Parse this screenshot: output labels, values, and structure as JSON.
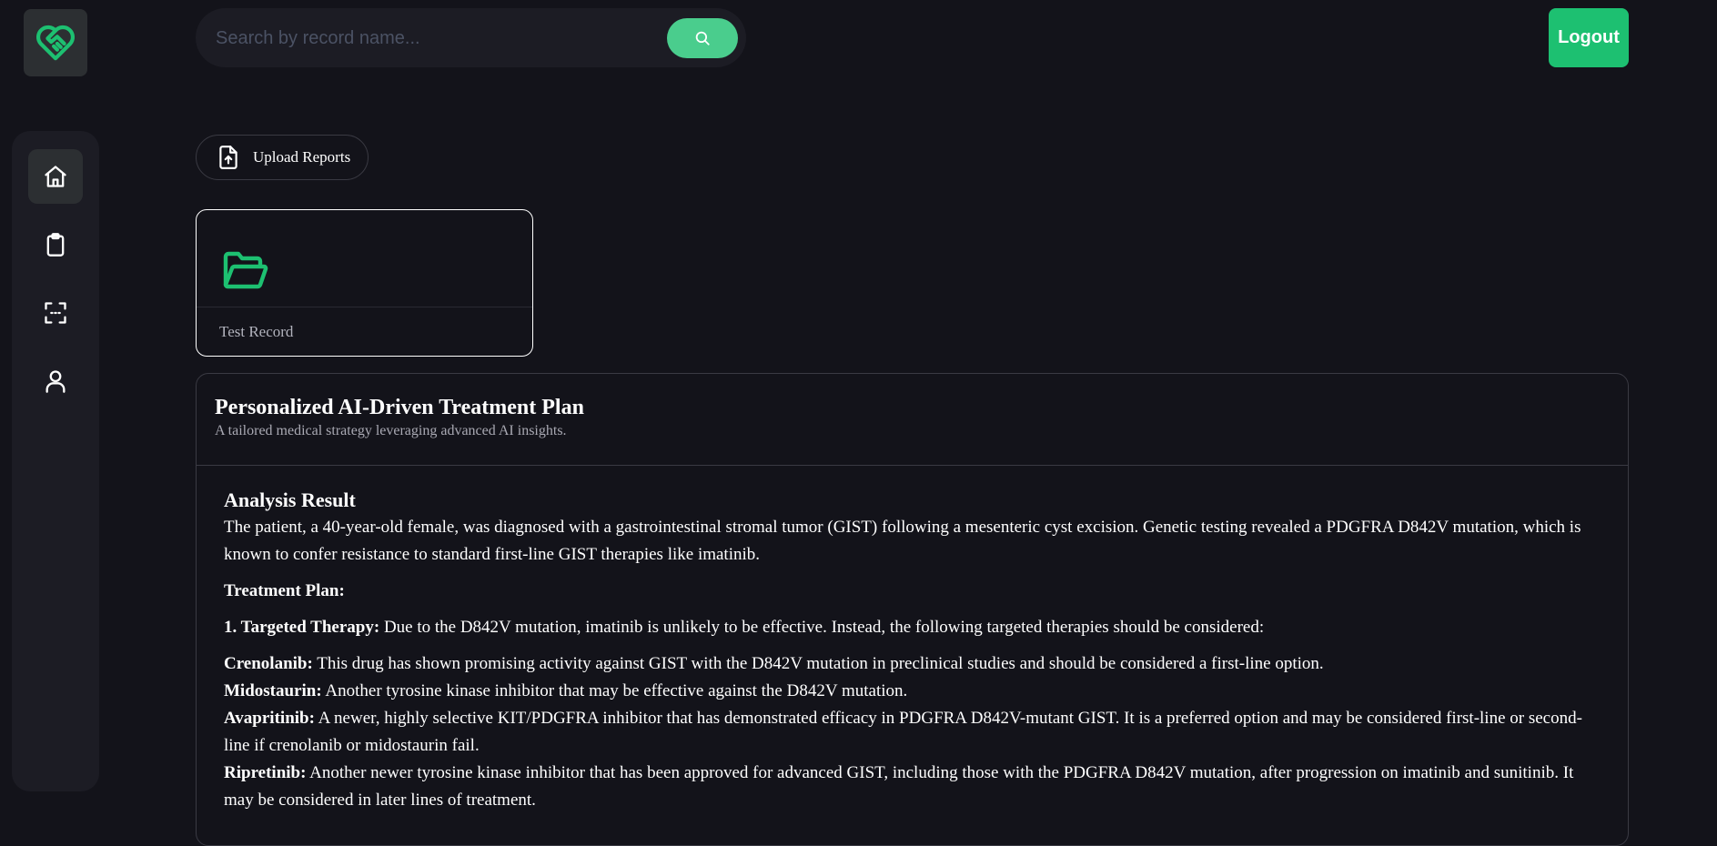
{
  "header": {
    "search_placeholder": "Search by record name...",
    "logout_label": "Logout"
  },
  "sidebar": {
    "items": [
      {
        "name": "home",
        "active": true
      },
      {
        "name": "records"
      },
      {
        "name": "scan"
      },
      {
        "name": "profile"
      }
    ]
  },
  "upload": {
    "label": "Upload Reports"
  },
  "records": [
    {
      "name": "Test Record"
    }
  ],
  "plan": {
    "title": "Personalized AI-Driven Treatment Plan",
    "subtitle": "A tailored medical strategy leveraging advanced AI insights.",
    "analysis_heading": "Analysis Result",
    "intro": "The patient, a 40-year-old female, was diagnosed with a gastrointestinal stromal tumor (GIST) following a mesenteric cyst excision. Genetic testing revealed a PDGFRA D842V mutation, which is known to confer resistance to standard first-line GIST therapies like imatinib.",
    "treatment_heading": "Treatment Plan:",
    "step1_label": "1. Targeted Therapy:",
    "step1_text": " Due to the D842V mutation, imatinib is unlikely to be effective. Instead, the following targeted therapies should be considered:",
    "drugs": [
      {
        "name": "Crenolanib:",
        "text": " This drug has shown promising activity against GIST with the D842V mutation in preclinical studies and should be considered a first-line option."
      },
      {
        "name": "Midostaurin:",
        "text": " Another tyrosine kinase inhibitor that may be effective against the D842V mutation."
      },
      {
        "name": "Avapritinib:",
        "text": " A newer, highly selective KIT/PDGFRA inhibitor that has demonstrated efficacy in PDGFRA D842V-mutant GIST. It is a preferred option and may be considered first-line or second-line if crenolanib or midostaurin fail."
      },
      {
        "name": "Ripretinib:",
        "text": " Another newer tyrosine kinase inhibitor that has been approved for advanced GIST, including those with the PDGFRA D842V mutation, after progression on imatinib and sunitinib. It may be considered in later lines of treatment."
      }
    ]
  },
  "colors": {
    "background": "#13131a",
    "panel": "#1c1c24",
    "accent": "#4acd8d",
    "logout": "#1dc071"
  }
}
